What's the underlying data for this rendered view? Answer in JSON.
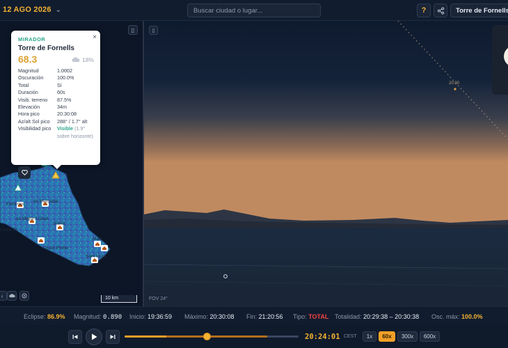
{
  "header": {
    "date": "12 AGO 2026",
    "search_placeholder": "Buscar ciudad o lugar...",
    "help_label": "?",
    "location": "Torre de Fornells"
  },
  "map": {
    "place_labels": [
      "es Mercadal",
      "Ferreries",
      "es Migjorn Gran",
      "Alaior",
      "Ciutat Pr",
      "Ciutat Porter",
      "Maó",
      "Sant Lluís"
    ],
    "scale": "10 km"
  },
  "popup": {
    "kind": "MIRADOR",
    "close_label": "×",
    "name": "Torre de Fornells",
    "score": "68.3",
    "cloud": "18%",
    "details": [
      {
        "k": "Magnitud",
        "v": "1.0002"
      },
      {
        "k": "Oscuración",
        "v": "100.0%"
      },
      {
        "k": "Total",
        "v": "Sí"
      },
      {
        "k": "Duración",
        "v": "60s"
      },
      {
        "k": "Visib. terreno",
        "v": "87.5%"
      },
      {
        "k": "Elevación",
        "v": "34m"
      },
      {
        "k": "Hora pico",
        "v": "20:30:08"
      },
      {
        "k": "Az/alt Sol pico",
        "v": "288° / 1.7° alt"
      }
    ],
    "vis_peak_label": "Visibilidad pico",
    "vis_peak_value": "Visible",
    "vis_peak_note": "(1.9° sobre horizonte)"
  },
  "sky": {
    "fov": "FOV 24°",
    "time_marker": "20:30"
  },
  "stats": {
    "eclipse_label": "Eclipse:",
    "eclipse_value": "86.9%",
    "magnitude_label": "Magnitud:",
    "magnitude_value": "0.890",
    "start_label": "Inicio:",
    "start_value": "19:36:59",
    "max_label": "Máximo:",
    "max_value": "20:30:08",
    "end_label": "Fin:",
    "end_value": "21:20:56",
    "type_label": "Tipo:",
    "type_value": "TOTAL",
    "totality_label": "Totalidad:",
    "totality_value": "20:29:38 – 20:30:38",
    "maxobs_label": "Osc. máx:",
    "maxobs_value": "100.0%"
  },
  "playback": {
    "clock": "20:24:01",
    "timezone": "CEST",
    "progress": 0.47,
    "speeds": [
      "1x",
      "60x",
      "300x",
      "600x"
    ],
    "active_speed": "60x"
  },
  "colors": {
    "accent": "#f2b233",
    "panel": "#111c2e",
    "total_red": "#ef4444",
    "mirador_green": "#2aa68a"
  },
  "icons": {
    "date_chevron": "chevron-down-icon",
    "share": "share-icon",
    "cloud": "cloud-icon",
    "favorite": "heart-icon",
    "expand": "expand-icon",
    "skip_back": "skip-back-icon",
    "play": "play-icon",
    "skip_forward": "skip-forward-icon"
  }
}
